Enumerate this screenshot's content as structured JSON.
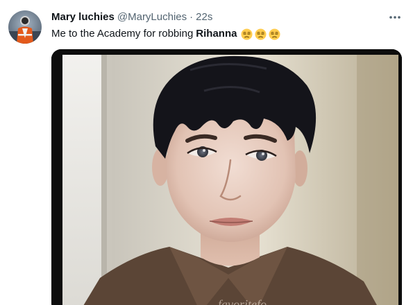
{
  "tweet": {
    "author_name": "Mary luchies",
    "author_handle": "@MaryLuchies",
    "separator": "·",
    "timestamp": "22s",
    "text_before": "Me to the Academy for robbing",
    "text_bold": "Rihanna",
    "emojis": [
      "unamused-face-emoji",
      "unamused-face-emoji",
      "unamused-face-emoji"
    ],
    "media_watermark": "favoritefo"
  },
  "icons": {
    "more": "more-horizontal-icon"
  },
  "colors": {
    "primary_text": "#0f1419",
    "secondary_text": "#536471",
    "background": "#ffffff",
    "emoji_yellow": "#ffcc4d"
  }
}
